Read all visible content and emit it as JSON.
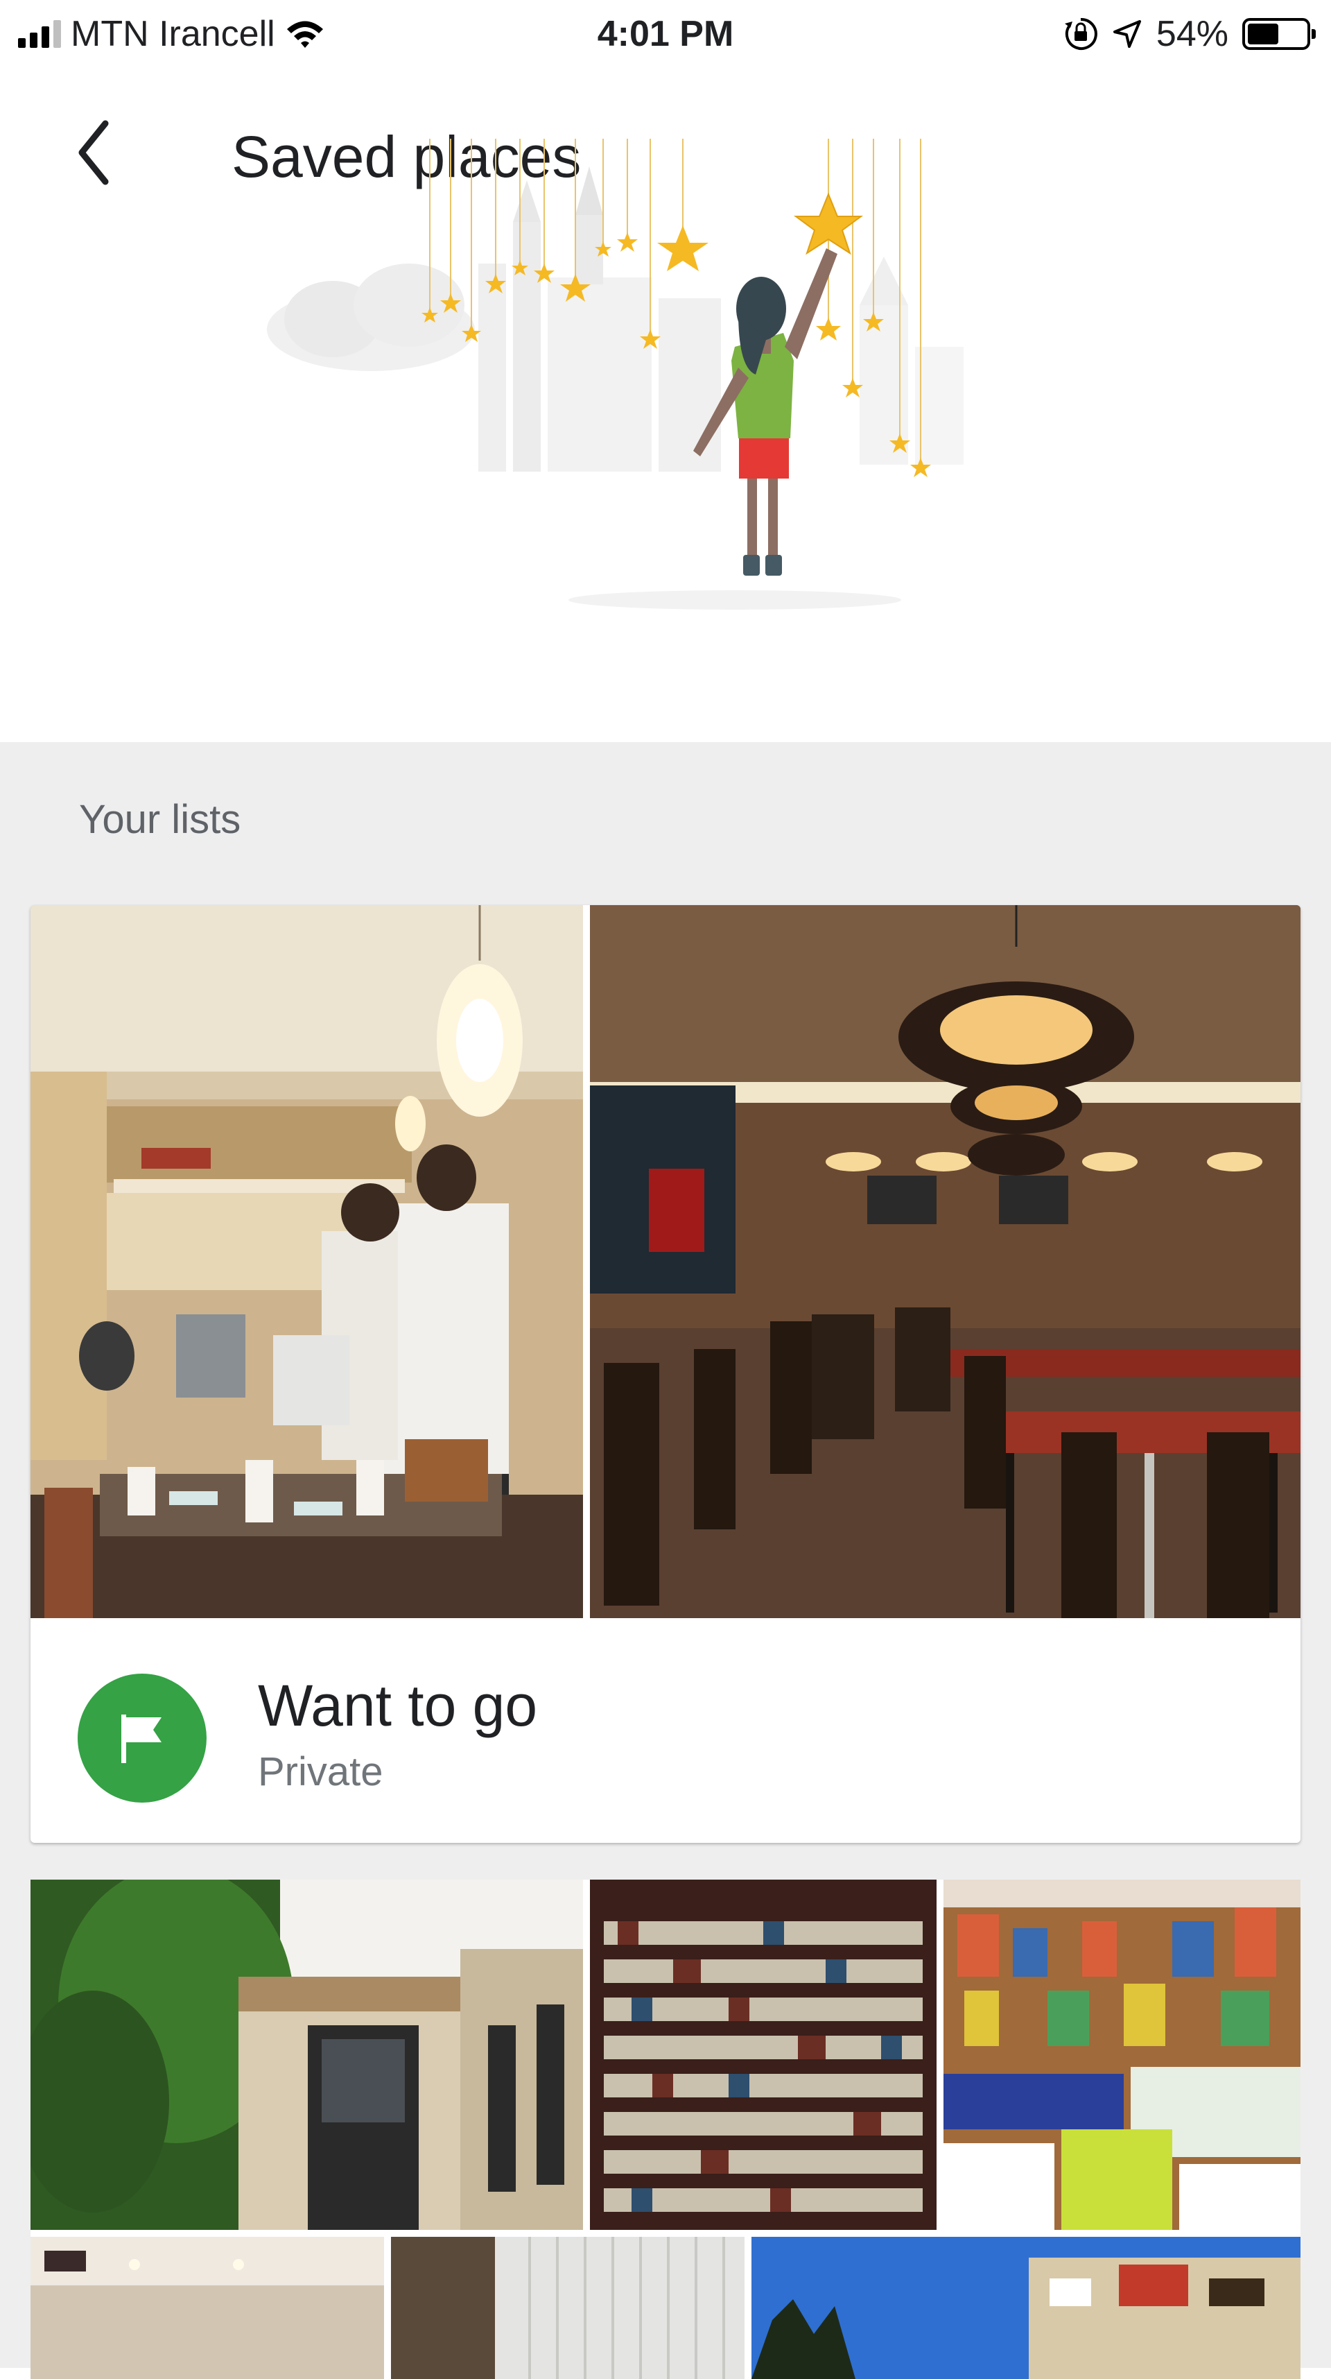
{
  "status_bar": {
    "carrier": "MTN Irancell",
    "time": "4:01 PM",
    "battery_percent": "54%",
    "battery_level": 0.54,
    "signal_bars": 3,
    "icons": [
      "signal-icon",
      "wifi-icon",
      "orientation-lock-icon",
      "location-arrow-icon",
      "battery-icon"
    ]
  },
  "header": {
    "title": "Saved places",
    "back_icon": "chevron-left-icon"
  },
  "lists_section": {
    "label": "Your lists",
    "lists": [
      {
        "name": "Want to go",
        "privacy": "Private",
        "icon": "flag-icon",
        "icon_color": "#34a245"
      }
    ]
  },
  "colors": {
    "accent_green": "#34a245",
    "section_background": "#eeeeef",
    "title_text": "#202124",
    "secondary_text": "#70757a"
  }
}
